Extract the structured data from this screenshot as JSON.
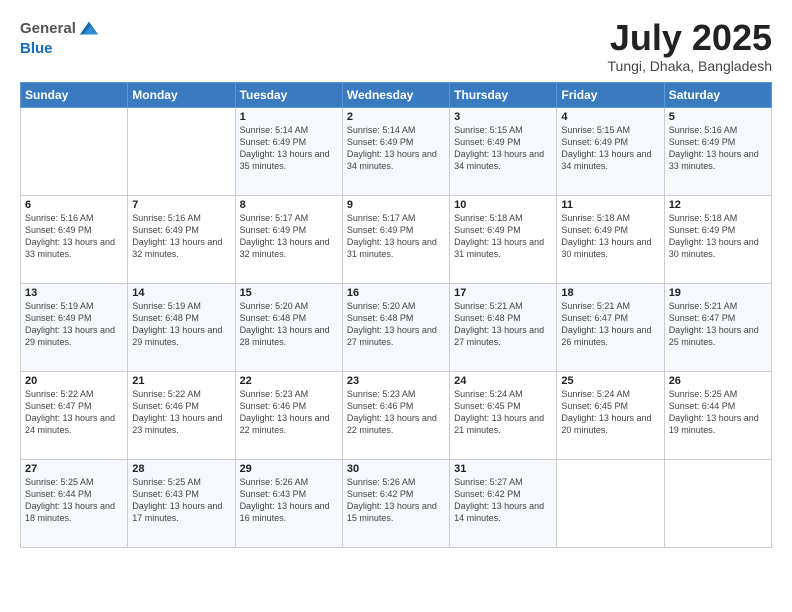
{
  "header": {
    "logo_line1": "General",
    "logo_line2": "Blue",
    "title": "July 2025",
    "subtitle": "Tungi, Dhaka, Bangladesh"
  },
  "days_of_week": [
    "Sunday",
    "Monday",
    "Tuesday",
    "Wednesday",
    "Thursday",
    "Friday",
    "Saturday"
  ],
  "weeks": [
    [
      {
        "day": "",
        "sunrise": "",
        "sunset": "",
        "daylight": ""
      },
      {
        "day": "",
        "sunrise": "",
        "sunset": "",
        "daylight": ""
      },
      {
        "day": "1",
        "sunrise": "Sunrise: 5:14 AM",
        "sunset": "Sunset: 6:49 PM",
        "daylight": "Daylight: 13 hours and 35 minutes."
      },
      {
        "day": "2",
        "sunrise": "Sunrise: 5:14 AM",
        "sunset": "Sunset: 6:49 PM",
        "daylight": "Daylight: 13 hours and 34 minutes."
      },
      {
        "day": "3",
        "sunrise": "Sunrise: 5:15 AM",
        "sunset": "Sunset: 6:49 PM",
        "daylight": "Daylight: 13 hours and 34 minutes."
      },
      {
        "day": "4",
        "sunrise": "Sunrise: 5:15 AM",
        "sunset": "Sunset: 6:49 PM",
        "daylight": "Daylight: 13 hours and 34 minutes."
      },
      {
        "day": "5",
        "sunrise": "Sunrise: 5:16 AM",
        "sunset": "Sunset: 6:49 PM",
        "daylight": "Daylight: 13 hours and 33 minutes."
      }
    ],
    [
      {
        "day": "6",
        "sunrise": "Sunrise: 5:16 AM",
        "sunset": "Sunset: 6:49 PM",
        "daylight": "Daylight: 13 hours and 33 minutes."
      },
      {
        "day": "7",
        "sunrise": "Sunrise: 5:16 AM",
        "sunset": "Sunset: 6:49 PM",
        "daylight": "Daylight: 13 hours and 32 minutes."
      },
      {
        "day": "8",
        "sunrise": "Sunrise: 5:17 AM",
        "sunset": "Sunset: 6:49 PM",
        "daylight": "Daylight: 13 hours and 32 minutes."
      },
      {
        "day": "9",
        "sunrise": "Sunrise: 5:17 AM",
        "sunset": "Sunset: 6:49 PM",
        "daylight": "Daylight: 13 hours and 31 minutes."
      },
      {
        "day": "10",
        "sunrise": "Sunrise: 5:18 AM",
        "sunset": "Sunset: 6:49 PM",
        "daylight": "Daylight: 13 hours and 31 minutes."
      },
      {
        "day": "11",
        "sunrise": "Sunrise: 5:18 AM",
        "sunset": "Sunset: 6:49 PM",
        "daylight": "Daylight: 13 hours and 30 minutes."
      },
      {
        "day": "12",
        "sunrise": "Sunrise: 5:18 AM",
        "sunset": "Sunset: 6:49 PM",
        "daylight": "Daylight: 13 hours and 30 minutes."
      }
    ],
    [
      {
        "day": "13",
        "sunrise": "Sunrise: 5:19 AM",
        "sunset": "Sunset: 6:49 PM",
        "daylight": "Daylight: 13 hours and 29 minutes."
      },
      {
        "day": "14",
        "sunrise": "Sunrise: 5:19 AM",
        "sunset": "Sunset: 6:48 PM",
        "daylight": "Daylight: 13 hours and 29 minutes."
      },
      {
        "day": "15",
        "sunrise": "Sunrise: 5:20 AM",
        "sunset": "Sunset: 6:48 PM",
        "daylight": "Daylight: 13 hours and 28 minutes."
      },
      {
        "day": "16",
        "sunrise": "Sunrise: 5:20 AM",
        "sunset": "Sunset: 6:48 PM",
        "daylight": "Daylight: 13 hours and 27 minutes."
      },
      {
        "day": "17",
        "sunrise": "Sunrise: 5:21 AM",
        "sunset": "Sunset: 6:48 PM",
        "daylight": "Daylight: 13 hours and 27 minutes."
      },
      {
        "day": "18",
        "sunrise": "Sunrise: 5:21 AM",
        "sunset": "Sunset: 6:47 PM",
        "daylight": "Daylight: 13 hours and 26 minutes."
      },
      {
        "day": "19",
        "sunrise": "Sunrise: 5:21 AM",
        "sunset": "Sunset: 6:47 PM",
        "daylight": "Daylight: 13 hours and 25 minutes."
      }
    ],
    [
      {
        "day": "20",
        "sunrise": "Sunrise: 5:22 AM",
        "sunset": "Sunset: 6:47 PM",
        "daylight": "Daylight: 13 hours and 24 minutes."
      },
      {
        "day": "21",
        "sunrise": "Sunrise: 5:22 AM",
        "sunset": "Sunset: 6:46 PM",
        "daylight": "Daylight: 13 hours and 23 minutes."
      },
      {
        "day": "22",
        "sunrise": "Sunrise: 5:23 AM",
        "sunset": "Sunset: 6:46 PM",
        "daylight": "Daylight: 13 hours and 22 minutes."
      },
      {
        "day": "23",
        "sunrise": "Sunrise: 5:23 AM",
        "sunset": "Sunset: 6:46 PM",
        "daylight": "Daylight: 13 hours and 22 minutes."
      },
      {
        "day": "24",
        "sunrise": "Sunrise: 5:24 AM",
        "sunset": "Sunset: 6:45 PM",
        "daylight": "Daylight: 13 hours and 21 minutes."
      },
      {
        "day": "25",
        "sunrise": "Sunrise: 5:24 AM",
        "sunset": "Sunset: 6:45 PM",
        "daylight": "Daylight: 13 hours and 20 minutes."
      },
      {
        "day": "26",
        "sunrise": "Sunrise: 5:25 AM",
        "sunset": "Sunset: 6:44 PM",
        "daylight": "Daylight: 13 hours and 19 minutes."
      }
    ],
    [
      {
        "day": "27",
        "sunrise": "Sunrise: 5:25 AM",
        "sunset": "Sunset: 6:44 PM",
        "daylight": "Daylight: 13 hours and 18 minutes."
      },
      {
        "day": "28",
        "sunrise": "Sunrise: 5:25 AM",
        "sunset": "Sunset: 6:43 PM",
        "daylight": "Daylight: 13 hours and 17 minutes."
      },
      {
        "day": "29",
        "sunrise": "Sunrise: 5:26 AM",
        "sunset": "Sunset: 6:43 PM",
        "daylight": "Daylight: 13 hours and 16 minutes."
      },
      {
        "day": "30",
        "sunrise": "Sunrise: 5:26 AM",
        "sunset": "Sunset: 6:42 PM",
        "daylight": "Daylight: 13 hours and 15 minutes."
      },
      {
        "day": "31",
        "sunrise": "Sunrise: 5:27 AM",
        "sunset": "Sunset: 6:42 PM",
        "daylight": "Daylight: 13 hours and 14 minutes."
      },
      {
        "day": "",
        "sunrise": "",
        "sunset": "",
        "daylight": ""
      },
      {
        "day": "",
        "sunrise": "",
        "sunset": "",
        "daylight": ""
      }
    ]
  ]
}
